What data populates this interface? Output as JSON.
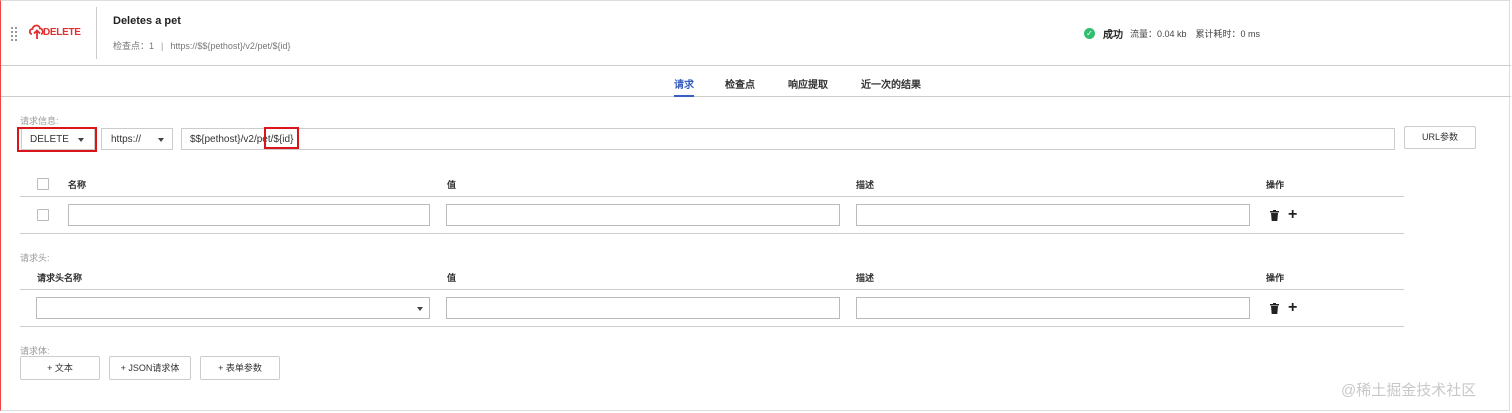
{
  "header": {
    "method_badge": "DELETE",
    "title": "Deletes a pet",
    "checkpoint_label": "检查点：",
    "checkpoint_count": "1",
    "separator": "|",
    "url": "https://$${pethost}/v2/pet/${id}",
    "status": "成功",
    "traffic": "流量：0.04 kb",
    "elapsed": "累计耗时：0 ms",
    "status_color": "#2fbf71"
  },
  "tabs": [
    {
      "label": "请求",
      "active": true
    },
    {
      "label": "检查点",
      "active": false
    },
    {
      "label": "响应提取",
      "active": false
    },
    {
      "label": "近一次的结果",
      "active": false
    }
  ],
  "request": {
    "section_label": "请求信息:",
    "method": "DELETE",
    "protocol": "https://",
    "url_path": "$${pethost}/v2/pet/${id}",
    "url_params_button": "URL参数"
  },
  "params_table": {
    "headers": {
      "name": "名称",
      "value": "值",
      "desc": "描述",
      "action": "操作"
    }
  },
  "headers_section": {
    "section_label": "请求头:",
    "headers": {
      "name": "请求头名称",
      "value": "值",
      "desc": "描述",
      "action": "操作"
    }
  },
  "body_section": {
    "section_label": "请求体:",
    "buttons": [
      "+ 文本",
      "+ JSON请求体",
      "+ 表单参数"
    ]
  },
  "watermark": "@稀土掘金技术社区",
  "colors": {
    "accent": "#3b5fc0",
    "highlight": "#d9141b",
    "brand": "#e0302f"
  }
}
